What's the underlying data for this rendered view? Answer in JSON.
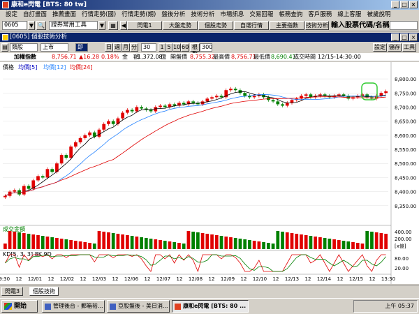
{
  "window": {
    "title": "康和e閃電 [BTS: 80 tw]",
    "minimize": "_",
    "maximize": "□",
    "close": "×"
  },
  "menu": [
    "設定",
    "自訂畫面",
    "推薦畫面",
    "行情走勢(國)",
    "行情走勢(期)",
    "盤後分析",
    "技術分析",
    "市場訊息",
    "交易回報",
    "帳務查詢",
    "客戶服務",
    "線上客服",
    "被歲說明"
  ],
  "toolbar": {
    "code": "0605",
    "tool_select": "證券常用工具",
    "buttons": [
      "閃電1",
      "大盤走勢",
      "個股走勢",
      "自選行情",
      "主要指數",
      "技術分析"
    ],
    "input_label": "輸入股票代碼/名稱:",
    "input_value": ""
  },
  "inner_window": {
    "title": "[0605] 個股技術分析",
    "buttons": [
      "設定",
      "儲存",
      "工具"
    ]
  },
  "controls": {
    "type": "類股",
    "market": "上市",
    "indicator": "即",
    "periods": [
      "日",
      "週",
      "月",
      "分"
    ],
    "interval": "30",
    "minutes": [
      "1",
      "5",
      "10",
      "60"
    ],
    "count_label": "根數",
    "count": "300"
  },
  "quote": {
    "name": "加權指數",
    "price": "8,756.71",
    "change": "▲16.28",
    "pct": "0.18%",
    "amount_label": "金　額",
    "amount": "1,372.08",
    "unit": "億",
    "open_label": "開盤價",
    "open": "8,755.32",
    "high_label": "最高價",
    "high": "8,756.71",
    "low_label": "最低價",
    "low": "8,690.41",
    "time_label": "成交時間",
    "time": "12/15-14:30:00"
  },
  "chart_data": {
    "type": "line",
    "title": "價格 均價[5] 均價[12] 均價[24]",
    "price_legend": [
      "價格",
      "均價[5]",
      "均價[12]",
      "均價[24]"
    ],
    "ylim": [
      8300,
      8820
    ],
    "yticks": [
      8800,
      8750,
      8700,
      8650,
      8600,
      8550,
      8500,
      8450,
      8400,
      8350
    ],
    "yticks_label": [
      "8,800.00",
      "8,750.00",
      "8,700.00",
      "8,650.00",
      "8,600.00",
      "8,550.00",
      "8,500.00",
      "8,450.00",
      "8,400.00",
      "8,350.00"
    ],
    "xticks": [
      "09:30",
      "12",
      "12/01",
      "12",
      "12/02",
      "12",
      "12/03",
      "12",
      "12/06",
      "12",
      "12/07",
      "12",
      "12/08",
      "12",
      "12/09",
      "12",
      "12/10",
      "12",
      "12/13",
      "12",
      "12/14",
      "12",
      "12/15",
      "12",
      "13:30"
    ],
    "close": [
      8385,
      8400,
      8405,
      8390,
      8420,
      8410,
      8440,
      8455,
      8450,
      8480,
      8470,
      8500,
      8530,
      8520,
      8560,
      8575,
      8590,
      8600,
      8610,
      8595,
      8620,
      8640,
      8650,
      8640,
      8660,
      8680,
      8690,
      8685,
      8700,
      8695,
      8690,
      8685,
      8700,
      8705,
      8700,
      8710,
      8705,
      8715,
      8710,
      8720,
      8715,
      8710,
      8720,
      8730,
      8735,
      8740,
      8735,
      8760,
      8765,
      8760,
      8750,
      8740,
      8735,
      8740,
      8745,
      8735,
      8725,
      8720,
      8710,
      8705,
      8715,
      8725,
      8730,
      8740,
      8745,
      8735,
      8740,
      8745,
      8740,
      8735,
      8740,
      8745,
      8740,
      8730,
      8735,
      8740,
      8745,
      8735,
      8730,
      8740,
      8750,
      8756
    ],
    "volume_title": "成交金額",
    "volume_yticks": [
      "400.00",
      "200.00",
      "[x億]"
    ],
    "kd_title": "KD[5, 3, 3] 8K 9D",
    "kd_yticks": [
      "80.00",
      "20.00"
    ],
    "highlight_color": "#33cc33"
  },
  "tabs": [
    "閃電3",
    "個股技術"
  ],
  "taskbar": {
    "start": "開始",
    "tasks": [
      "管理後台 - 郵箱裕...",
      "亞股盤後 - 美日消...",
      "康和e閃電 [BTS: 80 ..."
    ],
    "clock": "上午 05:37"
  }
}
